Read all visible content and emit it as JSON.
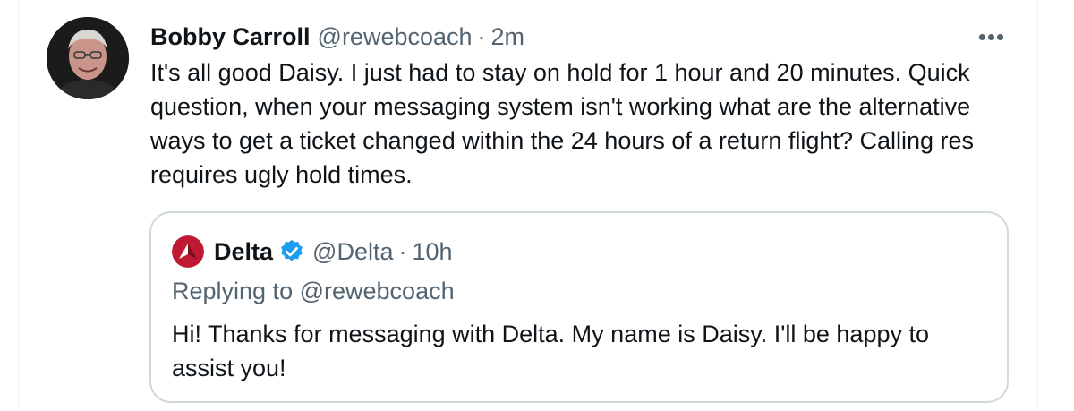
{
  "tweet": {
    "author_name": "Bobby Carroll",
    "handle": "@rewebcoach",
    "separator": "·",
    "time": "2m",
    "more_label": "•••",
    "avatar_icon": "user-avatar-photo",
    "text": "It's all good Daisy. I just had to stay on hold for 1 hour and 20 minutes. Quick question, when your messaging system isn't working what are the alternative ways to get a ticket changed within the 24 hours of a return flight? Calling res requires ugly hold times."
  },
  "quoted_tweet": {
    "author_name": "Delta",
    "verified_icon": "verified-badge-icon",
    "handle": "@Delta",
    "separator": "·",
    "time": "10h",
    "logo_icon": "delta-logo-icon",
    "replying_to_prefix": "Replying to",
    "replying_to_handle": "@rewebcoach",
    "text": "Hi! Thanks for messaging with Delta. My name is Daisy. I'll be happy to assist you!"
  },
  "colors": {
    "text_primary": "#0f1419",
    "text_secondary": "#536471",
    "border": "#cfd9de",
    "verified_blue": "#1d9bf0",
    "delta_red": "#c01933",
    "delta_dark_red": "#7a0f24"
  }
}
